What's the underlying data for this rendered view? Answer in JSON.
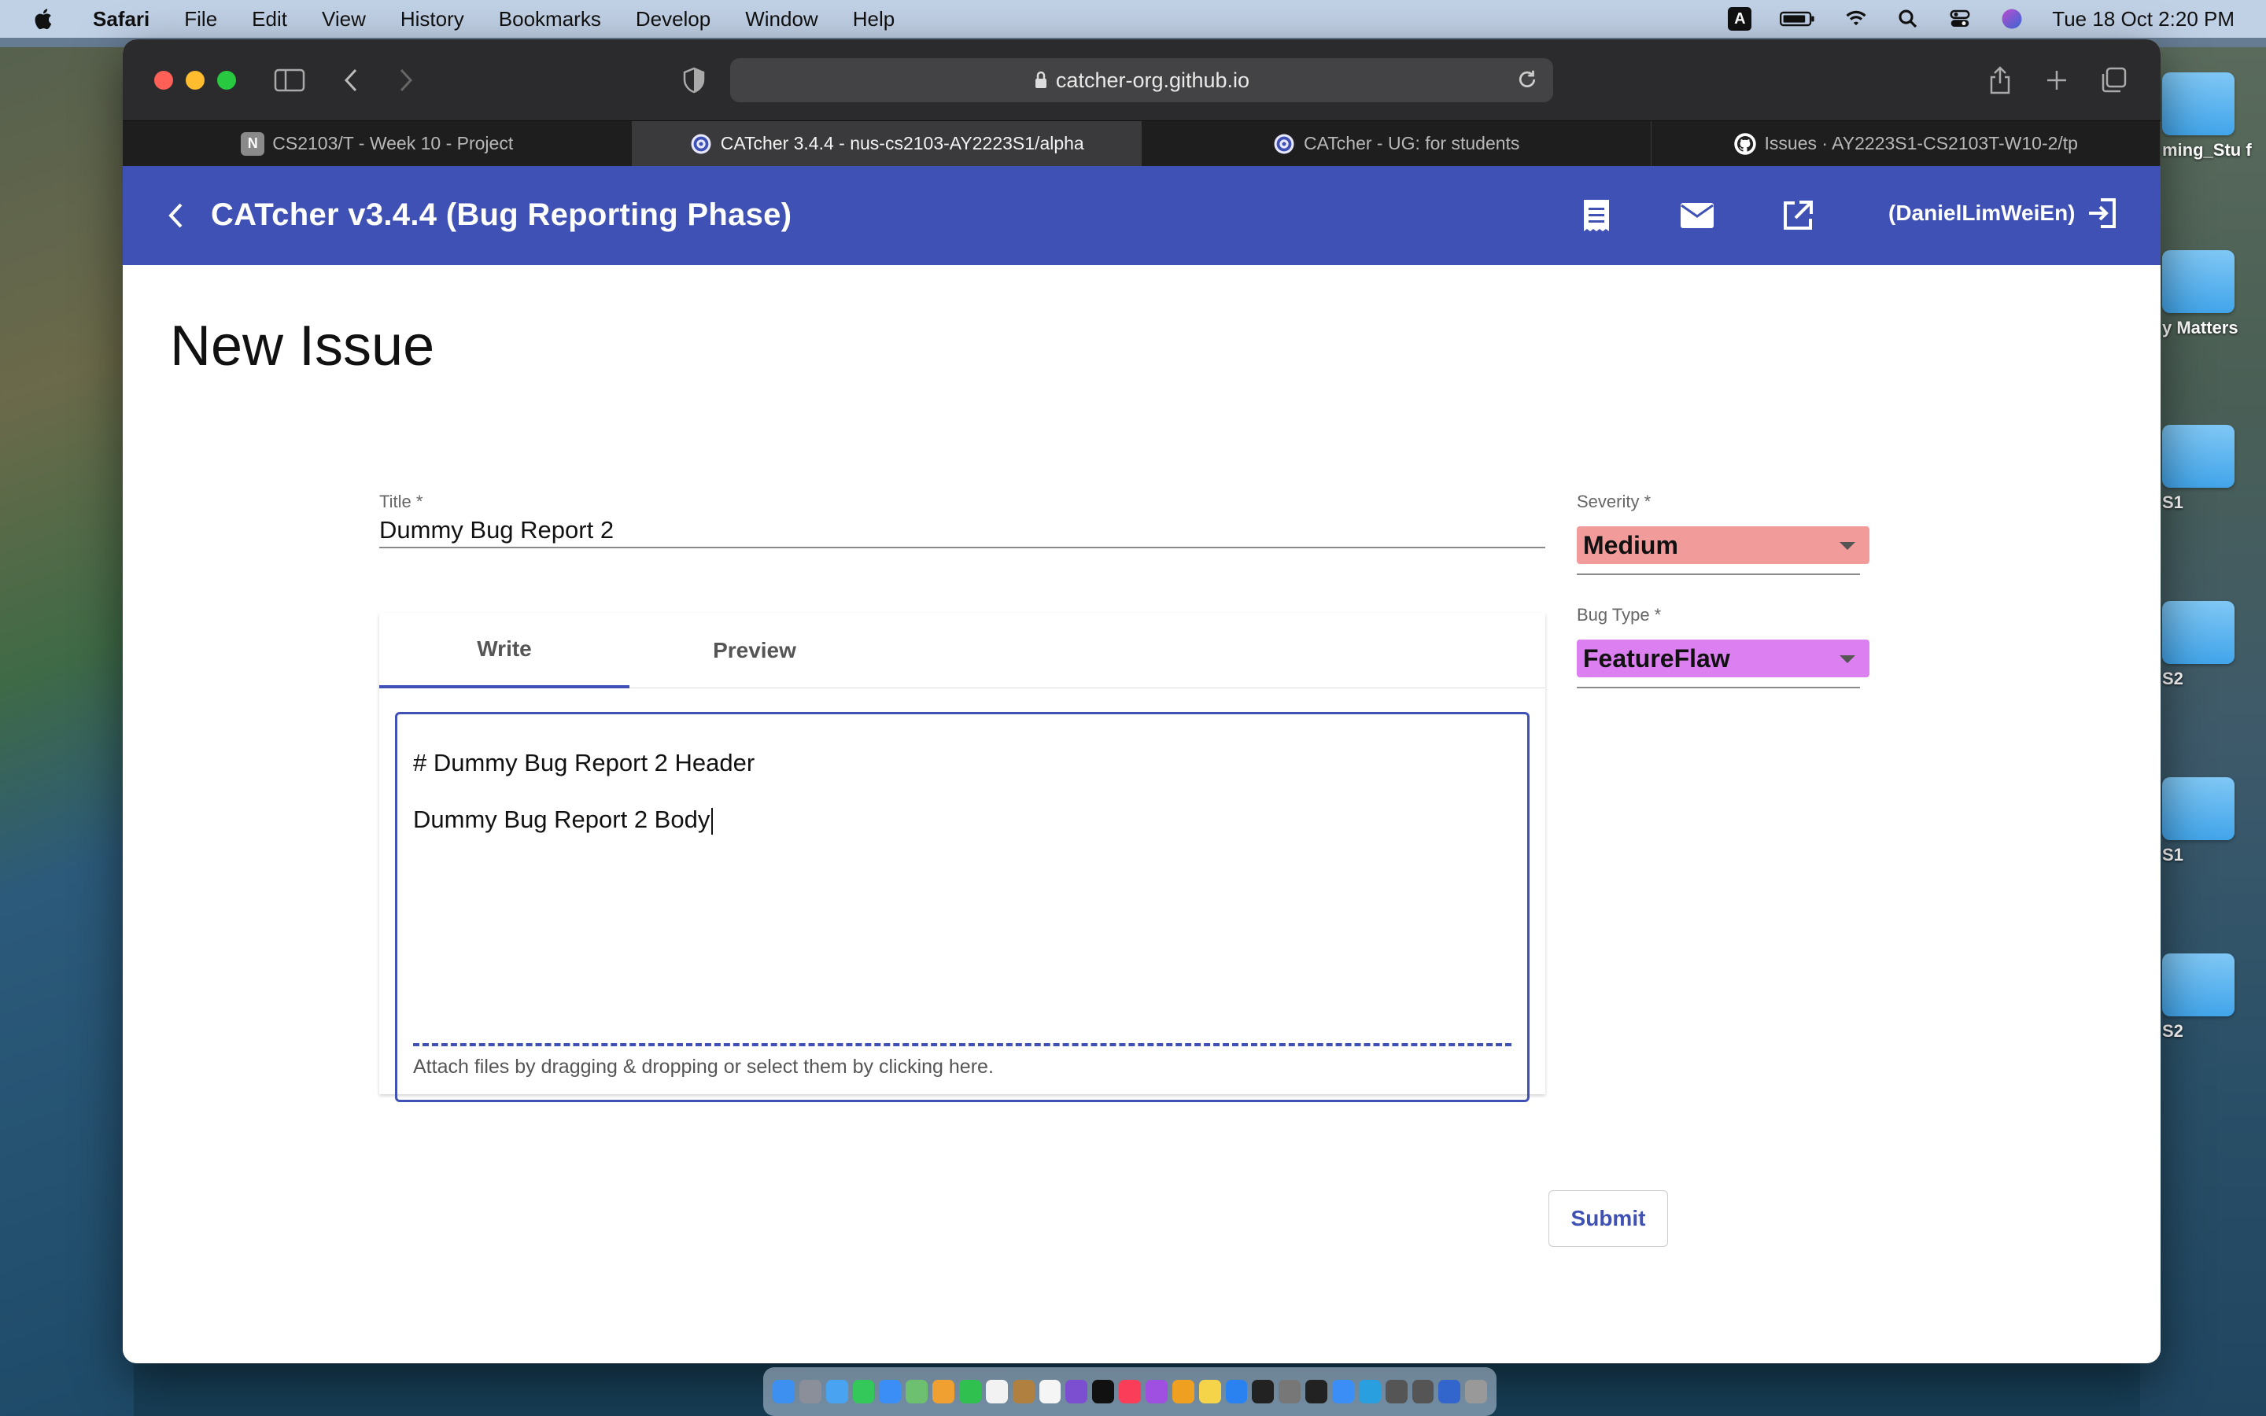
{
  "menubar": {
    "app_name": "Safari",
    "items": [
      "File",
      "Edit",
      "View",
      "History",
      "Bookmarks",
      "Develop",
      "Window",
      "Help"
    ],
    "input_indicator": "A",
    "datetime": "Tue 18 Oct  2:20 PM"
  },
  "desktop": {
    "labels": [
      "ming_Stu f",
      "y Matters",
      "S1",
      "S2",
      "S1",
      "S2"
    ]
  },
  "browser": {
    "url": "catcher-org.github.io",
    "tabs": [
      {
        "label": "CS2103/T - Week 10 - Project",
        "icon": "notion-icon",
        "favicon_text": "N"
      },
      {
        "label": "CATcher 3.4.4 - nus-cs2103-AY2223S1/alpha",
        "icon": "catcher-icon"
      },
      {
        "label": "CATcher - UG: for students",
        "icon": "catcher-icon"
      },
      {
        "label": "Issues · AY2223S1-CS2103T-W10-2/tp",
        "icon": "github-icon"
      }
    ]
  },
  "app": {
    "title": "CATcher v3.4.4  (Bug Reporting Phase)",
    "user": "(DanielLimWeiEn)",
    "accent_color": "#3f51b5",
    "icons": [
      "view-list-icon",
      "mail-icon",
      "open-in-new-icon",
      "logout-icon"
    ]
  },
  "form": {
    "page_title": "New Issue",
    "title_label": "Title *",
    "title_value": "Dummy Bug Report 2",
    "severity_label": "Severity *",
    "severity_value": "Medium",
    "severity_color": "#f19b9b",
    "bug_type_label": "Bug Type *",
    "bug_type_value": "FeatureFlaw",
    "bug_type_color": "#dc7ff0",
    "tab_write": "Write",
    "tab_preview": "Preview",
    "body_line1": "# Dummy Bug Report 2 Header",
    "body_line2": "Dummy Bug Report 2 Body",
    "attach_text": "Attach files by dragging & dropping or select them by clicking here.",
    "submit_label": "Submit"
  }
}
